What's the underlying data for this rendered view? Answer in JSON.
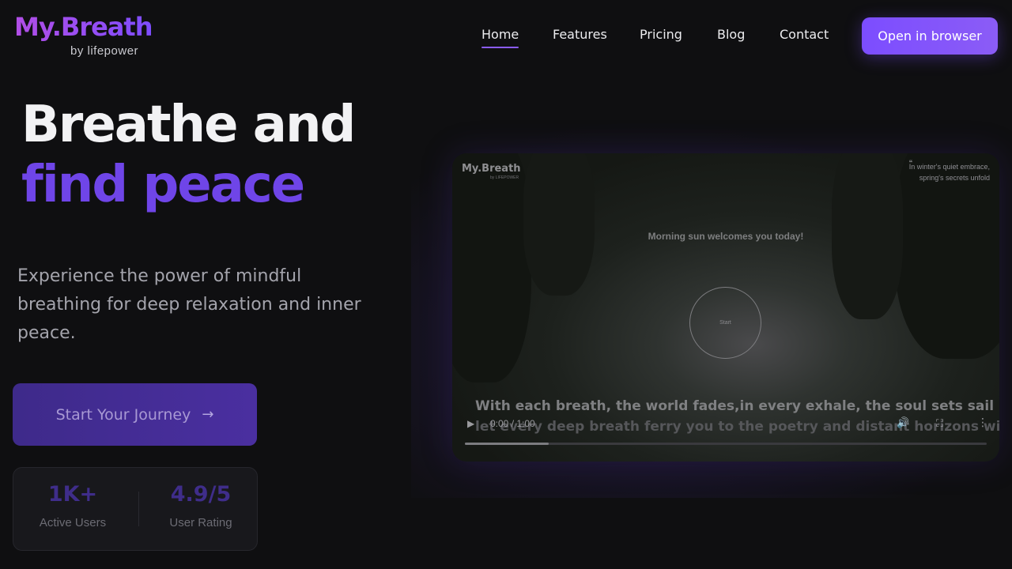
{
  "brand": {
    "name": "My.Breath",
    "tagline": "by lifepower",
    "accent": "#7c4dff"
  },
  "nav": {
    "items": [
      {
        "label": "Home",
        "active": true
      },
      {
        "label": "Features",
        "active": false
      },
      {
        "label": "Pricing",
        "active": false
      },
      {
        "label": "Blog",
        "active": false
      },
      {
        "label": "Contact",
        "active": false
      }
    ],
    "cta_label": "Open in browser"
  },
  "hero": {
    "title_line1": "Breathe and",
    "title_line2": "find peace",
    "description": "Experience the power of mindful breathing for deep relaxation and inner peace.",
    "cta_label": "Start Your Journey",
    "cta_icon": "arrow-right-icon"
  },
  "stats": [
    {
      "value": "1K+",
      "label": "Active Users"
    },
    {
      "value": "4.9/5",
      "label": "User Rating"
    }
  ],
  "video": {
    "logo": "My.Breath",
    "logo_sub": "by LIFEPOWER",
    "quote_line1": "In winter's quiet embrace,",
    "quote_line2": "spring's secrets unfold",
    "quote_mark": "“",
    "greeting": "Morning sun welcomes you today!",
    "circle_label": "Start",
    "caption_line1": "With each breath, the world fades,in every exhale, the soul sets sail",
    "caption_line2": "let every deep breath ferry you to the poetry and distant horizons within.",
    "time": "0:00 / 1:00",
    "progress_fraction": 0.16
  }
}
